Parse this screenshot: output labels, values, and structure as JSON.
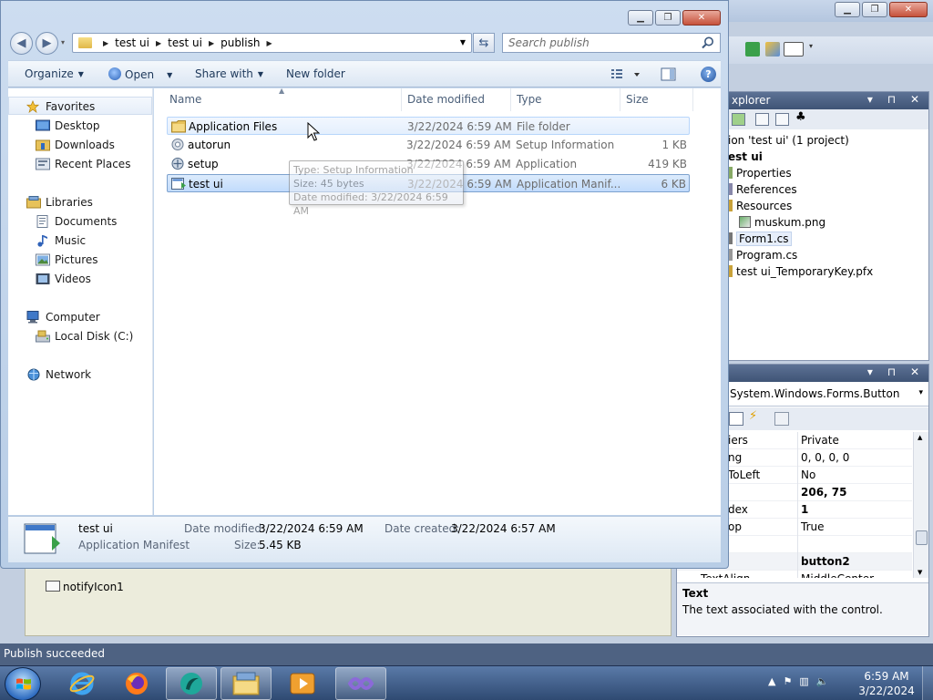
{
  "explorer": {
    "breadcrumb": [
      "test ui",
      "test ui",
      "publish"
    ],
    "search_placeholder": "Search publish",
    "toolbar": {
      "organize": "Organize",
      "open": "Open",
      "share_with": "Share with",
      "new_folder": "New folder"
    },
    "nav": {
      "favorites": "Favorites",
      "desktop": "Desktop",
      "downloads": "Downloads",
      "recent_places": "Recent Places",
      "libraries": "Libraries",
      "documents": "Documents",
      "music": "Music",
      "pictures": "Pictures",
      "videos": "Videos",
      "computer": "Computer",
      "local_disk": "Local Disk (C:)",
      "network": "Network"
    },
    "columns": {
      "name": "Name",
      "date_modified": "Date modified",
      "type": "Type",
      "size": "Size"
    },
    "files": [
      {
        "name": "Application Files",
        "date": "3/22/2024 6:59 AM",
        "type": "File folder",
        "size": "",
        "icon": "folder-icon"
      },
      {
        "name": "autorun",
        "date": "3/22/2024 6:59 AM",
        "type": "Setup Information",
        "size": "1 KB",
        "icon": "setup-information-icon"
      },
      {
        "name": "setup",
        "date": "3/22/2024 6:59 AM",
        "type": "Application",
        "size": "419 KB",
        "icon": "application-icon"
      },
      {
        "name": "test ui",
        "date": "3/22/2024 6:59 AM",
        "type": "Application Manif...",
        "size": "6 KB",
        "icon": "manifest-icon"
      }
    ],
    "tooltip": {
      "type": "Type: Setup Information",
      "size": "Size: 45 bytes",
      "date": "Date modified: 3/22/2024 6:59 AM"
    },
    "details": {
      "name": "test ui",
      "type": "Application Manifest",
      "date_modified_label": "Date modified:",
      "date_modified": "3/22/2024 6:59 AM",
      "size_label": "Size:",
      "size": "5.45 KB",
      "date_created_label": "Date created:",
      "date_created": "3/22/2024 6:57 AM"
    }
  },
  "vs": {
    "solution_explorer": {
      "title": "xplorer",
      "items": [
        "ion 'test ui' (1 project)",
        "est ui",
        "Properties",
        "References",
        "Resources",
        "muskum.png",
        "Form1.cs",
        "Program.cs",
        "test ui_TemporaryKey.pfx"
      ]
    },
    "properties": {
      "object": "System.Windows.Forms.Button",
      "rows": [
        {
          "name": "iers",
          "value": "Private",
          "bold": false
        },
        {
          "name": "ng",
          "value": "0, 0, 0, 0",
          "bold": false
        },
        {
          "name": "ToLeft",
          "value": "No",
          "bold": false
        },
        {
          "name": "",
          "value": "206, 75",
          "bold": true
        },
        {
          "name": "dex",
          "value": "1",
          "bold": true
        },
        {
          "name": "op",
          "value": "True",
          "bold": false
        },
        {
          "name": "",
          "value": "",
          "bold": false
        },
        {
          "name": "",
          "value": "button2",
          "bold": true
        },
        {
          "name": "TextAlign",
          "value": "MiddleCenter",
          "bold": false
        }
      ],
      "desc_title": "Text",
      "desc_text": "The text associated with the control."
    },
    "tray_item": "notifyIcon1",
    "status": "Publish succeeded"
  },
  "taskbar": {
    "time": "6:59 AM",
    "date": "3/22/2024"
  },
  "colors": {
    "selection": "#c1dbfc",
    "vs_panel_header": "#4a6080",
    "taskbar": "#2f4a72"
  }
}
